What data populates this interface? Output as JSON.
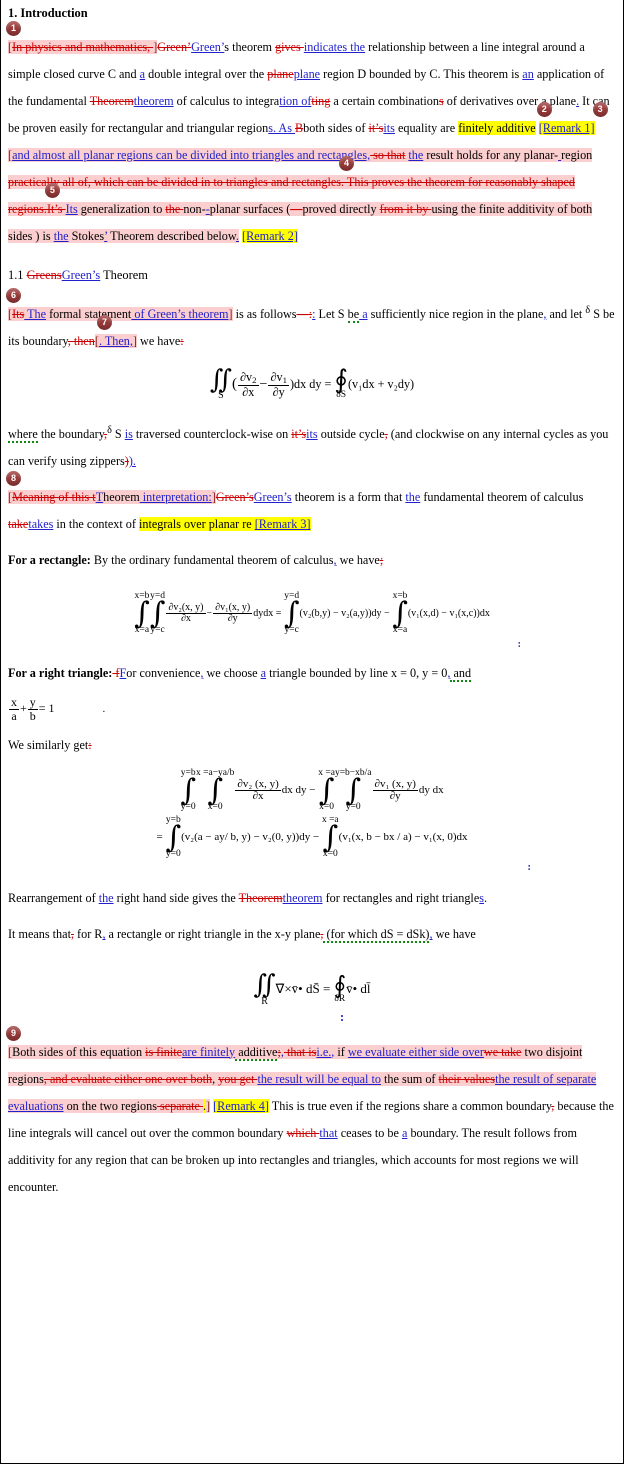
{
  "document": {
    "section_title": "1. Introduction",
    "subsection_title_pre": "1.1 ",
    "subsection_del": "Greens",
    "subsection_ins": "Green’s",
    "subsection_post": " Theorem"
  },
  "markers": {
    "m1": "1",
    "m2": "2",
    "m3": "3",
    "m4": "4",
    "m5": "5",
    "m6": "6",
    "m7": "7",
    "m8": "8",
    "m9": "9"
  },
  "remarks": {
    "r1": "[Remark 1]",
    "r2": "[Remark 2]",
    "r3": "[Remark 3]",
    "r4": "[Remark 4]"
  },
  "p1": {
    "del_in_physics": "In physics and mathematics, ",
    "del_green": "Green’",
    "ins_green": "Green’",
    "t_s_theorem": "s theorem ",
    "del_gives": "gives ",
    "ins_indicates": "indicates the",
    "t_rel": " relationship between a line integral around a simple closed curve C and ",
    "ins_a": "a",
    "t_double": " double integral over the ",
    "del_plane": "plane",
    "ins_plane": "plane",
    "t_region_d": " region D bounded by C. This theorem is ",
    "ins_an": "an",
    "t_application": " application of the fundamental ",
    "del_theorem_cap": "Theorem",
    "ins_theorem": "theorem",
    "t_of_calculus": " of calculus to integra",
    "ins_tion_of": "tion of",
    "del_ting": "ting",
    "t_certain": " a certain combination",
    "del_s": "s",
    "t_of_derivs": " of derivatives over a plane",
    "ins_period": ".",
    "t_can_be_proven": " It can be proven easily for rectangular and triangular region",
    "ins_s_period": "s.",
    "ins_as": " As ",
    "del_B": "B",
    "t_both_sides": "both sides of ",
    "del_its_apos": "it’s",
    "ins_its": "its",
    "t_equality_are": " equality are ",
    "hl_finitely_additive": "finitely additive",
    "ins_and_almost": "and almost all planar regions can be divided into triangles and rectangles,",
    "del_so_that": " so that",
    "ins_the": "the",
    "t_result_holds": " result holds for any planar-",
    "ins_space": " ",
    "t_region": "region",
    "del_practically": " practically  all  of,  which  can  be  divided in to triangles and rectangles",
    "del_this_proves": ". This proves     the theorem for reasonably shaped regions.",
    "del_its_apo": "It’s ",
    "ins_Its": "Its",
    "t_generalization": " generalization to ",
    "del_the": "the ",
    "t_non": "non-",
    "ins_hyphen": "-",
    "t_planar_surfaces": "planar surfaces (",
    "del_dash": "—",
    "t_proved_directly": "proved directly ",
    "del_from_it_by": "from it by ",
    "t_using_finite": "using the finite additivity of both sides ) is ",
    "ins_the2": "the",
    "t_stokes": " Stokes",
    "ins_apos": "’",
    "t_theorem_below": " Theorem described below",
    "ins_dot": "."
  },
  "p2": {
    "del_its": "Its",
    "ins_the": " The",
    "t_formal": " formal statement",
    "ins_of_greens": " of Green’s theorem",
    "t_is_as_follows": " is as follows",
    "del_dash": "—",
    "del_colon": ":",
    "ins_colon": ":",
    "t_let_s": " Let S ",
    "t_be": "be",
    "ins_a": " a",
    "t_suff": " sufficiently nice region in the plane",
    "ins_comma": ",",
    "t_and_let": " and let ",
    "t_delta": "δ",
    "t_s_be_boundary": " S be its boundary",
    "del_then": ", then",
    "ins_then": ". Then,",
    "t_we_have": " we have",
    "del_colon2": ":"
  },
  "eq1": {
    "lhs_dbl": "∬",
    "lhs_sub": "S",
    "num1": "∂v",
    "num1sub": "2",
    "den1": "∂x",
    "num2": "∂v",
    "num2sub": "1",
    "den2": "∂y",
    "dxdy": ")dx dy",
    "eq": "=",
    "oint": "∮",
    "oint_sub": "δS",
    "rhs": "(v₁dx + v₂dy)"
  },
  "p3": {
    "t_where": "where",
    "t_the_boundary": " the boundary",
    "del_comma": ",",
    "t_delta_s": " δ S ",
    "ins_is": "is",
    "t_traversed": " traversed counterclock-wise on ",
    "del_its": "it’s",
    "ins_its": "its",
    "t_outside_cycle": " outside cycle",
    "del_comma2": ",",
    "t_and_clockwise": " (and clockwise on any internal cycles as you can verify using zippers",
    "del_paren": ")",
    "ins_paren": ")."
  },
  "p4": {
    "del_meaning": "Meaning of this t",
    "ins_T": "T",
    "t_heorem": "heorem",
    "ins_interpretation": " interpretation:",
    "del_greens": "Green’s",
    "ins_greens": "Green’s",
    "t_theorem_is": " theorem is a form that ",
    "ins_the": "the",
    "t_fundamental": " fundamental theorem of calculus ",
    "del_take": "take",
    "ins_takes": "takes",
    "t_in_context": " in the context of ",
    "hl_integrals": "integrals over planar re"
  },
  "p5": {
    "lead": "For a rectangle:",
    "t_by_ordinary": " By the ordinary fundamental theorem of calculus",
    "ins_comma": ",",
    "t_we_have": " we have",
    "del_semicolon": ";"
  },
  "eq2": {
    "i1_top": "x=b",
    "i1_bot": "x=a",
    "i2_top": "y=d",
    "i2_bot": "y=c",
    "num1": "∂v₂(x, y)",
    "den1": "∂x",
    "minus": "−",
    "num2": "∂v₁(x, y)",
    "den2": "∂y",
    "dydx": "dydx",
    "eq": "=",
    "i3_top": "y=d",
    "i3_bot": "y=c",
    "term1": "(v₂(b,y) − v₂(a,y))dy",
    "minus2": "−",
    "i4_top": "x=b",
    "i4_bot": "x=a",
    "term2": "(v₁(x,d) − v₁(x,c))dx",
    "trailing_colon": ":"
  },
  "p6": {
    "lead": "For a right triangle:",
    "del_f": " f",
    "ins_F": "F",
    "t_or_conv": "or convenience",
    "ins_comma": ",",
    "t_we_choose": " we choose ",
    "ins_a": "a",
    "t_triangle": " triangle bounded by line x = 0, y = 0",
    "ins_comma2": ",",
    "t_and": " and"
  },
  "eq3": {
    "num_x": "x",
    "den_a": "a",
    "plus": "+",
    "num_y": "y",
    "den_b": "b",
    "eq": "= 1",
    "trailing_dot": "."
  },
  "p7": {
    "t_we_similarly": "We similarly  get",
    "del_colon": ":"
  },
  "eq4": {
    "i1_top": "y=b",
    "i1_bot": "y=0",
    "i2_top": "x =a−ya/b",
    "i2_bot": "x=0",
    "num1": "∂v₂ (x, y)",
    "den1": "∂x",
    "dxdy": "dx dy",
    "minus": "−",
    "i3_top": "x =a",
    "i3_bot": "x=0",
    "i4_top": "y=b−xb/a",
    "i4_bot": "y=0",
    "num2": "∂v₁ (x, y)",
    "den2": "∂y",
    "dydx": "dy dx",
    "eq": "=",
    "i5_top": "y=b",
    "i5_bot": "y=0",
    "term1": "(v₂(a − ay/ b, y) − v₂(0, y))dy",
    "minus2": "−",
    "i6_top": "x =a",
    "i6_bot": "x=0",
    "term2": "(v₁(x, b − bx / a) − v₁(x, 0)dx",
    "trailing_colon": ":"
  },
  "p8": {
    "t_rearrangement": "Rearrangement of ",
    "ins_the": "the",
    "t_rhs": " right hand side gives the ",
    "del_theorem": "Theorem",
    "ins_theorem": "theorem",
    "t_for_rect": " for rectangles and right triangle",
    "ins_s": "s",
    "t_period": "."
  },
  "p9": {
    "t_it_means": "It means that",
    "del_comma": ",",
    "t_for_r": " for R",
    "ins_comma": ",",
    "t_a_rect": " a rectangle or right triangle in the x-y plane",
    "del_comma2": ",",
    "t_for_which": " (for which dS = dSk)",
    "ins_comma2": ",",
    "t_we_have": " we have"
  },
  "eq5": {
    "dbl": "∬",
    "dbl_sub": "R",
    "grad": "∇̄",
    "times": "×",
    "v": "v̄",
    "dot": "•",
    "ds": "dS̄",
    "eq": "=",
    "oint": "∮",
    "oint_sub": "δR",
    "v2": "v̄",
    "dot2": "•",
    "dl": "dl̄",
    "trailing_colon": ":"
  },
  "p10": {
    "t_both_sides": "Both sides of this equation ",
    "del_is_finite": "is finite",
    "ins_are_finitely": "are finitely",
    "t_additive": " additive",
    "del_semicolon": ";",
    "ins_comma": ",",
    "del_that_is": " that is",
    "ins_ie": "i.e.",
    "ins_comma2": ",",
    "t_if": " if ",
    "ins_we_eval": "we evaluate either side over",
    "del_we_take": "we take",
    "t_two_disjoint": " two disjoint regions",
    "del_and_eval": ", and evaluate either one over both",
    "t_comma": ", ",
    "del_you_get": "you get ",
    "ins_result_will_be": "the result will be equal to",
    "t_the_sum_of": " the sum of ",
    "del_their_values": "their values",
    "ins_result_of_sep": "the result of separate evaluations",
    "t_on_two": " on the two regions",
    "del_separate": " separate    ",
    "hl_dot": ".",
    "t_this_is_true": " This is true even if the regions share a common boundary",
    "del_comma3": ",",
    "t_because": " because the line integrals will cancel out over the common boundary ",
    "del_which": "which ",
    "ins_that": "that",
    "t_ceases": " ceases to be ",
    "ins_a": "a",
    "t_boundary": " boundary. The result follows from additivity for any region that can be broken up into rectangles and triangles, which accounts for most regions we will encounter."
  },
  "colors": {
    "deletion": "#cc0000",
    "insertion": "#2222cc",
    "highlight": "#ffff00",
    "changed_block": "#fbcfcf",
    "marker_bg": "#9d3b3b"
  }
}
